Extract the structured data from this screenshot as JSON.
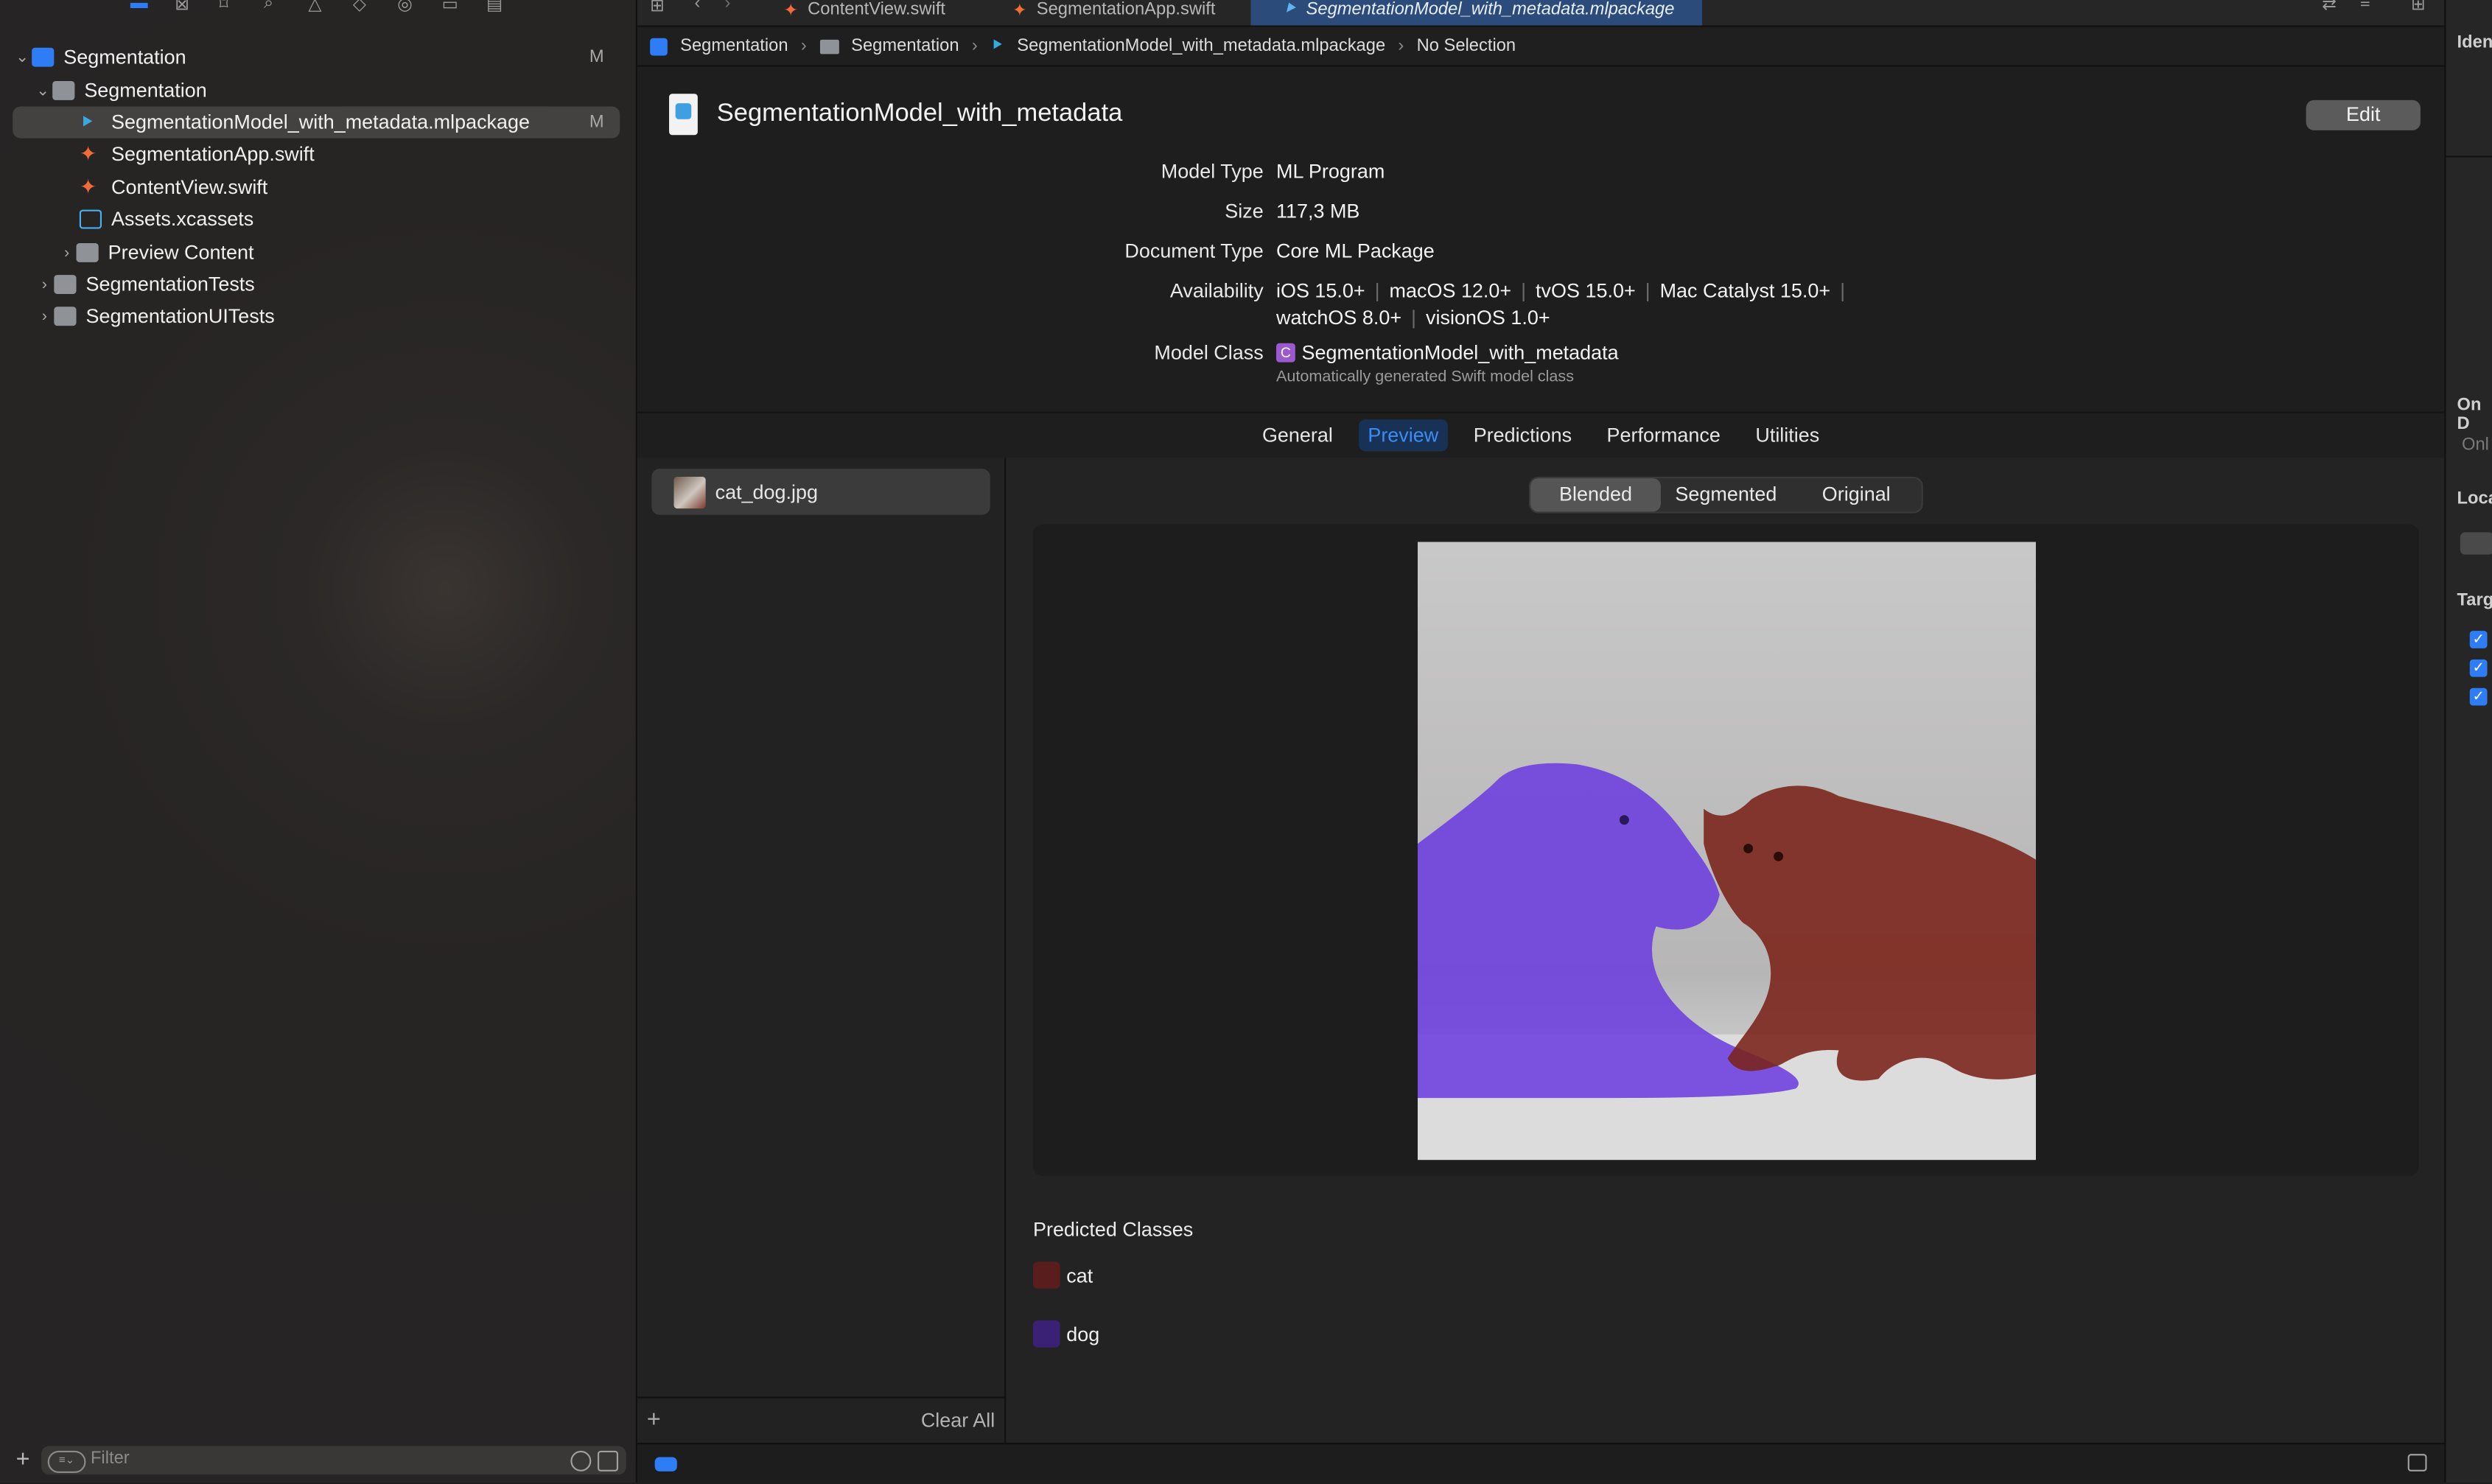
{
  "tabs": [
    {
      "label": "ContentView.swift"
    },
    {
      "label": "SegmentationApp.swift"
    },
    {
      "label": "SegmentationModel_with_metadata.mlpackage"
    }
  ],
  "navigator": {
    "items": [
      {
        "label": "Segmentation",
        "badge": "M"
      },
      {
        "label": "Segmentation"
      },
      {
        "label": "SegmentationModel_with_metadata.mlpackage",
        "badge": "M"
      },
      {
        "label": "SegmentationApp.swift"
      },
      {
        "label": "ContentView.swift"
      },
      {
        "label": "Assets.xcassets"
      },
      {
        "label": "Preview Content"
      },
      {
        "label": "SegmentationTests"
      },
      {
        "label": "SegmentationUITests"
      }
    ],
    "filter_placeholder": "Filter"
  },
  "breadcrumb": [
    "Segmentation",
    "Segmentation",
    "SegmentationModel_with_metadata.mlpackage",
    "No Selection"
  ],
  "model": {
    "title": "SegmentationModel_with_metadata",
    "edit_label": "Edit",
    "labels": {
      "model_type": "Model Type",
      "size": "Size",
      "document_type": "Document Type",
      "availability": "Availability",
      "model_class": "Model Class"
    },
    "model_type": "ML Program",
    "size": "117,3 MB",
    "document_type": "Core ML Package",
    "availability": [
      "iOS 15.0+",
      "macOS 12.0+",
      "tvOS 15.0+",
      "Mac Catalyst 15.0+",
      "watchOS 8.0+",
      "visionOS 1.0+"
    ],
    "model_class_badge": "C",
    "model_class": "SegmentationModel_with_metadata",
    "model_class_note": "Automatically generated Swift model class"
  },
  "detail_tabs": [
    "General",
    "Preview",
    "Predictions",
    "Performance",
    "Utilities"
  ],
  "preview": {
    "images": [
      {
        "name": "cat_dog.jpg"
      }
    ],
    "clear_all": "Clear All",
    "segments": [
      "Blended",
      "Segmented",
      "Original"
    ],
    "predicted_title": "Predicted Classes",
    "classes": [
      {
        "name": "cat",
        "color": "#5a1d1d"
      },
      {
        "name": "dog",
        "color": "#3b2175"
      }
    ]
  },
  "inspector": {
    "headers": [
      "Iden",
      "On D",
      "Onl",
      "Loca",
      "Targ"
    ]
  },
  "colors": {
    "accent": "#2f7df6",
    "cat_overlay": "#7a2218",
    "dog_overlay": "#6a3ae0"
  }
}
